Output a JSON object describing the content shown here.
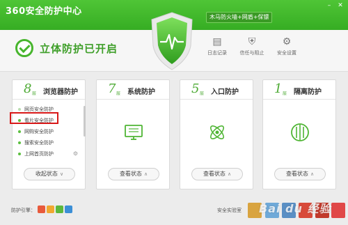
{
  "app": {
    "title": "360安全防护中心"
  },
  "header": {
    "promo": "木马防火墙+网盾+保镖"
  },
  "status": {
    "text": "立体防护已开启",
    "color": "#47b52d"
  },
  "tools": [
    {
      "label": "日志记录",
      "icon": "log-icon"
    },
    {
      "label": "信任与阻止",
      "icon": "trust-icon"
    },
    {
      "label": "安全设置",
      "icon": "gear-icon"
    }
  ],
  "cards": [
    {
      "num": "8",
      "unit": "层",
      "title": "浏览器防护",
      "button": "收起状态",
      "chevron": "∨"
    },
    {
      "num": "7",
      "unit": "层",
      "title": "系统防护",
      "button": "查看状态",
      "chevron": "∧",
      "icon": "monitor-icon"
    },
    {
      "num": "5",
      "unit": "层",
      "title": "入口防护",
      "button": "查看状态",
      "chevron": "∧",
      "icon": "atom-icon"
    },
    {
      "num": "1",
      "unit": "层",
      "title": "隔离防护",
      "button": "查看状态",
      "chevron": "∧",
      "icon": "isolation-icon"
    }
  ],
  "browser_features": [
    {
      "label": "网页安全防护"
    },
    {
      "label": "看片安全防护"
    },
    {
      "label": "网购安全防护"
    },
    {
      "label": "搜索安全防护"
    },
    {
      "label": "上网首页防护"
    }
  ],
  "bottom": {
    "engine_label": "防护引擎：",
    "lab_label": "安全实验室"
  },
  "watermark": "Bai du 经验",
  "colors": {
    "brand_green": "#3aae26",
    "highlight_red": "#d81818"
  }
}
